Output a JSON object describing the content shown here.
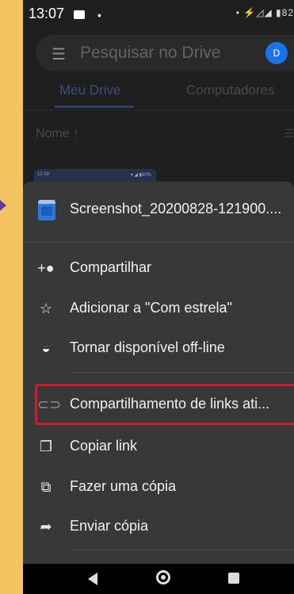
{
  "status": {
    "time": "13:07",
    "dot": "•",
    "right": "• ⚡◿◢ ▮82"
  },
  "search": {
    "menu_icon": "☰",
    "placeholder": "Pesquisar no Drive",
    "avatar": "D"
  },
  "tabs": [
    {
      "label": "Meu Drive"
    },
    {
      "label": "Computadores"
    }
  ],
  "sort": {
    "label": "Nome ↑"
  },
  "thumbnail": {
    "time": "12:18",
    "battery": "▾ ◢ ▮80%"
  },
  "sheet": {
    "file_name": "Screenshot_20200828-121900....",
    "items": [
      {
        "icon": "person-add-icon",
        "glyph": "+👤",
        "label": "Compartilhar"
      },
      {
        "icon": "star-icon",
        "glyph": "☆",
        "label": "Adicionar a \"Com estrela\""
      },
      {
        "icon": "offline-pin-icon",
        "glyph": "◒",
        "label": "Tornar disponível off-line"
      },
      {
        "icon": "link-icon",
        "glyph": "⊂⊃",
        "label": "Compartilhamento de links ati..."
      },
      {
        "icon": "copy-icon",
        "glyph": "❐",
        "label": "Copiar link"
      },
      {
        "icon": "file-copy-icon",
        "glyph": "⧉",
        "label": "Fazer uma cópia"
      },
      {
        "icon": "send-icon",
        "glyph": "➦",
        "label": "Enviar cópia"
      }
    ]
  },
  "colors": {
    "accent_highlight": "#d11a2a",
    "background": "#f3c45f",
    "sheet": "#383838"
  }
}
